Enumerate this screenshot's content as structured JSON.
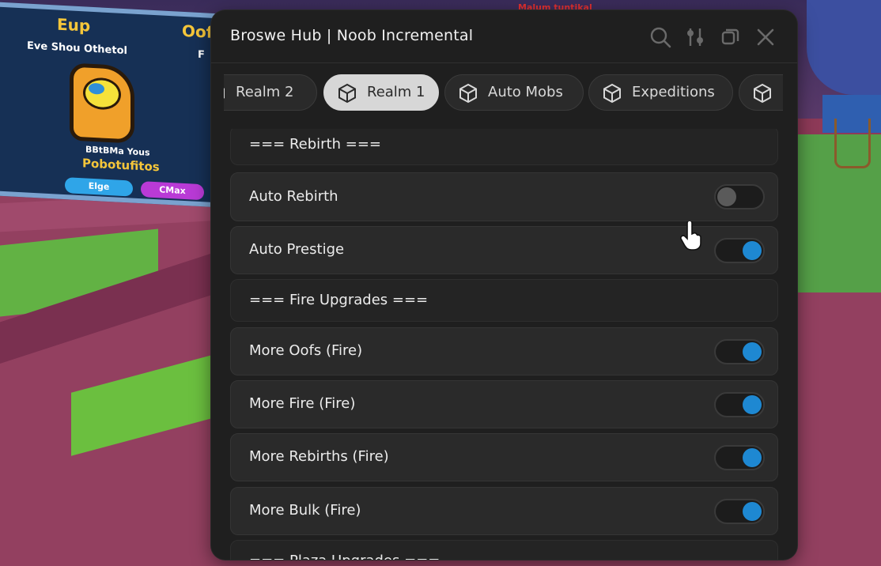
{
  "window": {
    "title": "Broswe Hub | Noob Incremental",
    "toolbar_icons": [
      "search-icon",
      "settings-sliders-icon",
      "minimize-icon",
      "close-icon"
    ]
  },
  "tabs": [
    {
      "label": "Realm 2",
      "icon": "cube-icon",
      "active": false
    },
    {
      "label": "Realm 1",
      "icon": "cube-icon",
      "active": true
    },
    {
      "label": "Auto Mobs",
      "icon": "cube-icon",
      "active": false
    },
    {
      "label": "Expeditions",
      "icon": "cube-icon",
      "active": false
    },
    {
      "label": "",
      "icon": "cube-icon",
      "active": false
    }
  ],
  "sections": {
    "rebirth_header": "=== Rebirth ===",
    "fire_header": "=== Fire Upgrades ===",
    "next_header": "=== Plaza Upgrades ==="
  },
  "toggles": {
    "auto_rebirth": {
      "label": "Auto Rebirth",
      "state": "off"
    },
    "auto_prestige": {
      "label": "Auto Prestige",
      "state": "on"
    },
    "more_oofs": {
      "label": "More Oofs (Fire)",
      "state": "on"
    },
    "more_fire": {
      "label": "More Fire (Fire)",
      "state": "on"
    },
    "more_rebirths": {
      "label": "More Rebirths (Fire)",
      "state": "on"
    },
    "more_bulk": {
      "label": "More Bulk (Fire)",
      "state": "on"
    }
  },
  "background": {
    "billboard": {
      "title_left": "Eup",
      "title_right": "Oof",
      "subtitle": "Eve Shou Othetol",
      "subtitle_right": "F",
      "caption_small": "BBtBMa Yous",
      "caption_big": "Pobotufitos",
      "button_left": "Elge",
      "button_right": "CMax"
    },
    "top_text": "Malum tuntikal"
  },
  "colors": {
    "accent_toggle": "#1e88d2",
    "window_bg": "#1f1f1f",
    "active_tab_bg": "#d7d7d7"
  }
}
